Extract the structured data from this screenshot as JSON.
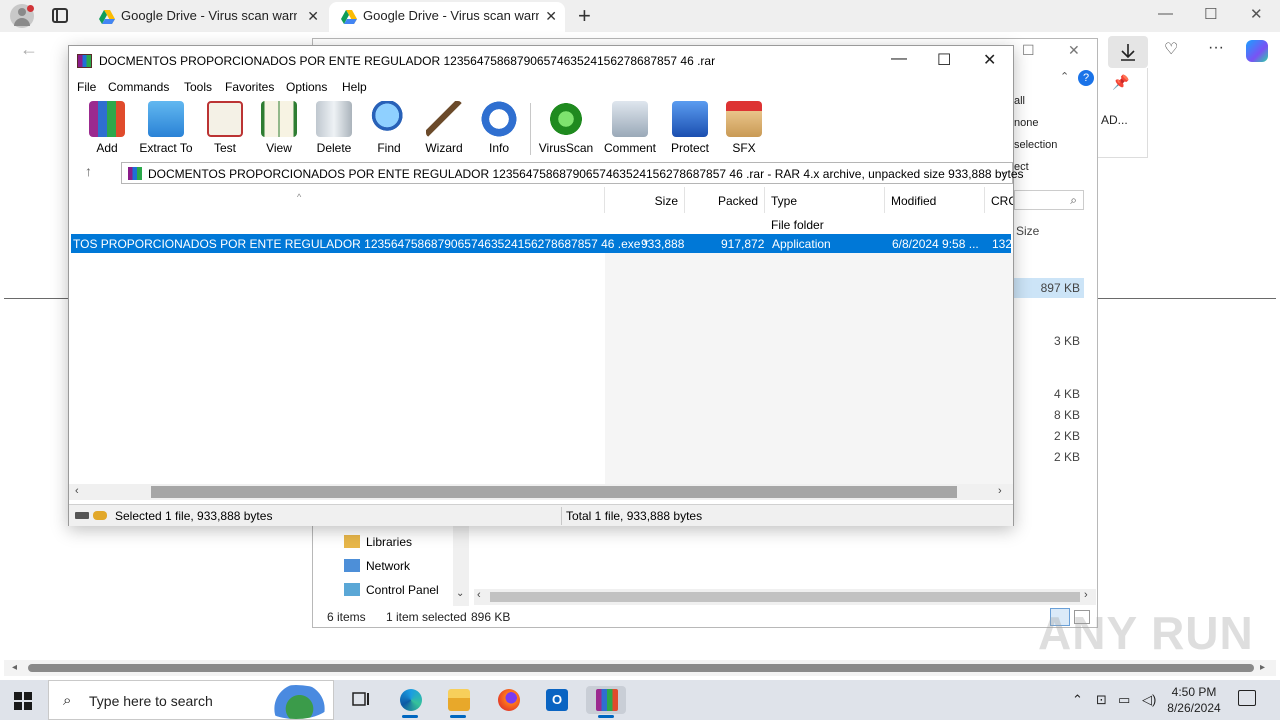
{
  "browser": {
    "tabs": [
      {
        "label": "Google Drive - Virus scan warning"
      },
      {
        "label": "Google Drive - Virus scan warning"
      }
    ],
    "new_tab": "+",
    "controls": {
      "minimize": "—",
      "maximize": "☐",
      "close": "✕"
    }
  },
  "explorer": {
    "right_panel": [
      "all",
      "none",
      "selection",
      "ect"
    ],
    "side_text": "AD...",
    "size_col_header": "Size",
    "sizes": [
      "897 KB",
      "3 KB",
      "4 KB",
      "8 KB",
      "2 KB",
      "2 KB"
    ],
    "nav": [
      {
        "label": "Libraries"
      },
      {
        "label": "Network"
      },
      {
        "label": "Control Panel"
      }
    ],
    "status": {
      "items": "6 items",
      "selected": "1 item selected",
      "size": "896 KB"
    }
  },
  "winrar": {
    "title": "DOCMENTOS PROPORCIONADOS POR ENTE REGULADOR 12356475868790657463524156278687857 46 .rar",
    "menu": [
      "File",
      "Commands",
      "Tools",
      "Favorites",
      "Options",
      "Help"
    ],
    "toolbar": [
      {
        "label": "Add",
        "icon": "archive-add-icon"
      },
      {
        "label": "Extract To",
        "icon": "folder-extract-icon"
      },
      {
        "label": "Test",
        "icon": "test-checklist-icon"
      },
      {
        "label": "View",
        "icon": "book-view-icon"
      },
      {
        "label": "Delete",
        "icon": "trash-icon"
      },
      {
        "label": "Find",
        "icon": "magnifier-icon"
      },
      {
        "label": "Wizard",
        "icon": "magic-wand-icon"
      },
      {
        "label": "Info",
        "icon": "info-icon"
      },
      {
        "label": "VirusScan",
        "icon": "bug-scan-icon"
      },
      {
        "label": "Comment",
        "icon": "comment-icon"
      },
      {
        "label": "Protect",
        "icon": "shield-icon"
      },
      {
        "label": "SFX",
        "icon": "sfx-box-icon"
      }
    ],
    "address": "DOCMENTOS PROPORCIONADOS POR ENTE REGULADOR 12356475868790657463524156278687857 46 .rar - RAR 4.x archive, unpacked size 933,888 bytes",
    "columns": {
      "size": "Size",
      "packed": "Packed",
      "type": "Type",
      "modified": "Modified",
      "crc": "CRC"
    },
    "parent_row_type": "File folder",
    "row": {
      "name": "TOS PROPORCIONADOS POR ENTE REGULADOR 12356475868790657463524156278687857 46 .exe *",
      "size": "933,888",
      "packed": "917,872",
      "type": "Application",
      "modified": "6/8/2024 9:58 ...",
      "crc": "132"
    },
    "status_left": "Selected 1 file, 933,888 bytes",
    "status_right": "Total 1 file, 933,888 bytes"
  },
  "watermark": "ANY RUN",
  "taskbar": {
    "search_placeholder": "Type here to search",
    "time": "4:50 PM",
    "date": "8/26/2024"
  },
  "colors": {
    "selection": "#0078d7",
    "accent": "#0067c0"
  }
}
